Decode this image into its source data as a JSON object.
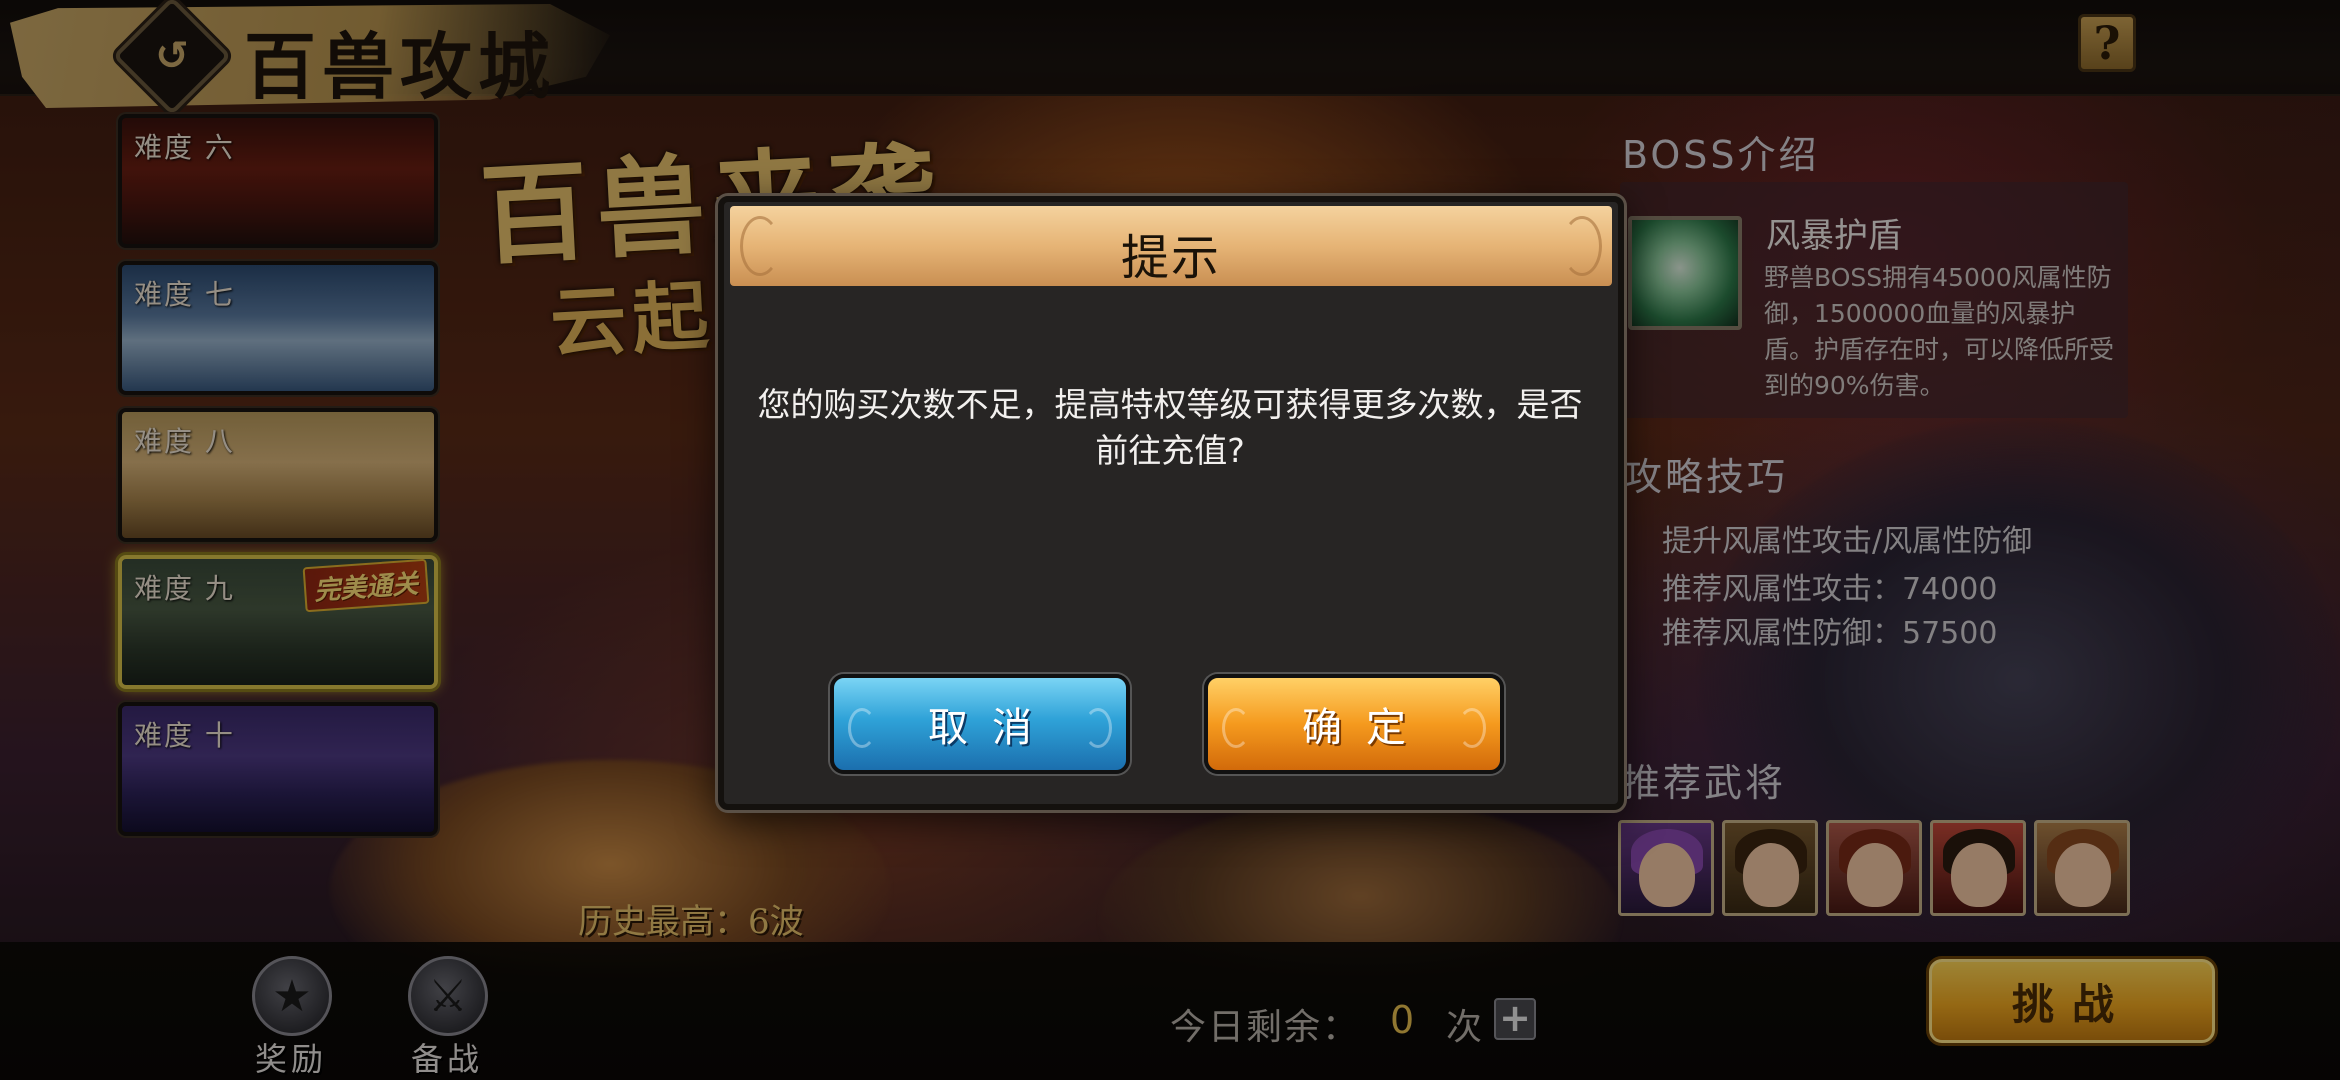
{
  "header": {
    "title": "百兽攻城",
    "back_icon": "back-swirl-icon",
    "help_label": "?"
  },
  "banner": {
    "title": "百兽来袭",
    "subtitle": "云起"
  },
  "difficulties": [
    {
      "label": "难度 六",
      "selected": false
    },
    {
      "label": "难度 七",
      "selected": false
    },
    {
      "label": "难度 八",
      "selected": false
    },
    {
      "label": "难度 九",
      "selected": true,
      "badge": "完美通关"
    },
    {
      "label": "难度 十",
      "selected": false
    }
  ],
  "boss": {
    "section_title": "BOSS介绍",
    "skill_name": "风暴护盾",
    "skill_icon": "storm-shield-icon",
    "skill_desc": "野兽BOSS拥有45000风属性防御，1500000血量的风暴护盾。护盾存在时，可以降低所受到的90%伤害。"
  },
  "strategy": {
    "section_title": "攻略技巧",
    "lines": [
      "提升风属性攻击/风属性防御",
      "推荐风属性攻击：74000",
      "推荐风属性防御：57500"
    ]
  },
  "recommend": {
    "section_title": "推荐武将",
    "heroes": [
      "hero-portrait",
      "hero-portrait",
      "hero-portrait",
      "hero-portrait",
      "hero-portrait"
    ]
  },
  "bottom": {
    "history_best": "历史最高：6波",
    "reward_label": "奖励",
    "prepare_label": "备战",
    "remaining_label": "今日剩余：",
    "remaining_count": "0",
    "remaining_unit": "次",
    "add_label": "+",
    "challenge_label": "挑战"
  },
  "modal": {
    "title": "提示",
    "message": "您的购买次数不足，提高特权等级可获得更多次数，是否前往充值?",
    "cancel_label": "取消",
    "confirm_label": "确定"
  },
  "colors": {
    "accent_gold": "#e8c050",
    "cancel_blue": "#2fa2d8",
    "confirm_orange": "#f59a1e",
    "selected_border": "#d8c24a"
  }
}
